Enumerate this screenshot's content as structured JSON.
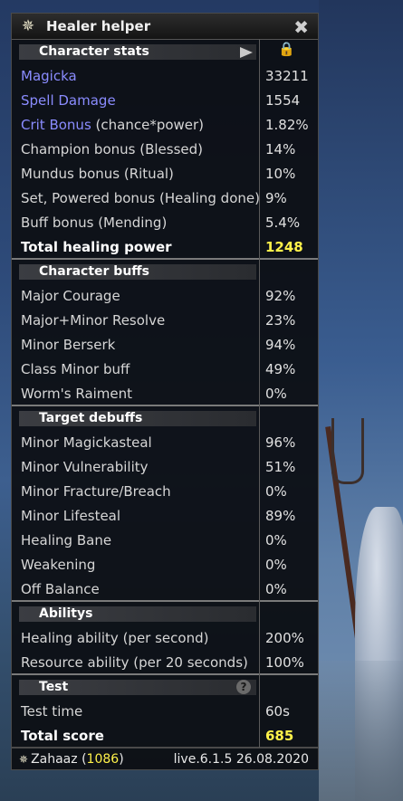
{
  "window": {
    "title": "Healer helper"
  },
  "sections": [
    {
      "title": "Character stats",
      "rows": [
        {
          "label": "Magicka",
          "value": "33211"
        },
        {
          "label": "Spell Damage",
          "value": "1554"
        },
        {
          "label": "Crit Bonus",
          "label_suffix": " (chance*power)",
          "value": "1.82%"
        },
        {
          "label": "Champion bonus (Blessed)",
          "value": "14%"
        },
        {
          "label": "Mundus bonus (Ritual)",
          "value": "10%"
        },
        {
          "label": "Set, Powered bonus (Healing done)",
          "value": "9%"
        },
        {
          "label": "Buff bonus (Mending)",
          "value": "5.4%"
        },
        {
          "label": "Total healing power",
          "value": "1248"
        }
      ]
    },
    {
      "title": "Character buffs",
      "rows": [
        {
          "label": "Major Courage",
          "value": "92%"
        },
        {
          "label": "Major+Minor Resolve",
          "value": "23%"
        },
        {
          "label": "Minor Berserk",
          "value": "94%"
        },
        {
          "label": "Class Minor buff",
          "value": "49%"
        },
        {
          "label": "Worm's Raiment",
          "value": "0%"
        }
      ]
    },
    {
      "title": "Target debuffs",
      "rows": [
        {
          "label": "Minor Magickasteal",
          "value": "96%"
        },
        {
          "label": "Minor Vulnerability",
          "value": "51%"
        },
        {
          "label": "Minor Fracture/Breach",
          "value": "0%"
        },
        {
          "label": "Minor Lifesteal",
          "value": "89%"
        },
        {
          "label": "Healing Bane",
          "value": "0%"
        },
        {
          "label": "Weakening",
          "value": "0%"
        },
        {
          "label": "Off Balance",
          "value": "0%"
        }
      ]
    },
    {
      "title": "Abilitys",
      "rows": [
        {
          "label": "Healing ability (per second)",
          "value": "200%"
        },
        {
          "label": "Resource ability (per 20 seconds)",
          "value": "100%"
        }
      ]
    },
    {
      "title": "Test",
      "rows": [
        {
          "label": "Test time",
          "value": "60s"
        },
        {
          "label": "Total score",
          "value": "685"
        }
      ]
    }
  ],
  "footer": {
    "user": "Zahaaz",
    "level_open": " (",
    "level": "1086",
    "level_close": ")",
    "version": "live.6.1.5 26.08.2020"
  },
  "colors": {
    "highlight_blue": "#8a8cff",
    "highlight_yellow": "#fff24a"
  },
  "icons": {
    "title": "compass-star-icon",
    "close": "close-x-icon",
    "play": "play-arrow-icon",
    "lock": "lock-icon",
    "help": "help-question-icon"
  }
}
